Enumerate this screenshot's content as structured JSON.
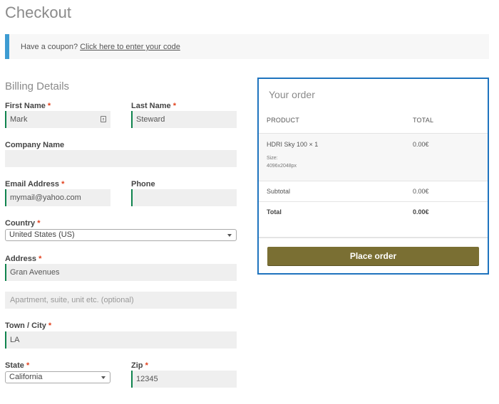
{
  "page": {
    "title": "Checkout"
  },
  "coupon": {
    "prompt": "Have a coupon?",
    "link": "Click here to enter your code"
  },
  "billing": {
    "title": "Billing Details",
    "required_mark": "*",
    "first_name": {
      "label": "First Name",
      "value": "Mark"
    },
    "last_name": {
      "label": "Last Name",
      "value": "Steward"
    },
    "company": {
      "label": "Company Name",
      "value": ""
    },
    "email": {
      "label": "Email Address",
      "value": "mymail@yahoo.com"
    },
    "phone": {
      "label": "Phone",
      "value": ""
    },
    "country": {
      "label": "Country",
      "value": "United States (US)"
    },
    "address": {
      "label": "Address",
      "value": "Gran Avenues",
      "line2_placeholder": "Apartment, suite, unit etc. (optional)"
    },
    "city": {
      "label": "Town / City",
      "value": "LA"
    },
    "state": {
      "label": "State",
      "value": "California"
    },
    "zip": {
      "label": "Zip",
      "value": "12345"
    }
  },
  "order": {
    "title": "Your order",
    "col_product": "PRODUCT",
    "col_total": "TOTAL",
    "item": {
      "name": "HDRI Sky 100  × 1",
      "total": "0.00€",
      "size_label": "Size:",
      "size_value": "4096x2048px"
    },
    "subtotal": {
      "label": "Subtotal",
      "value": "0.00€"
    },
    "total": {
      "label": "Total",
      "value": "0.00€"
    },
    "place_order": "Place order"
  },
  "colors": {
    "accent_bar": "#3d9cd2",
    "valid_field": "#0f834d",
    "required": "#e2401c",
    "order_border": "#1e73be",
    "button": "#7a6f33"
  }
}
